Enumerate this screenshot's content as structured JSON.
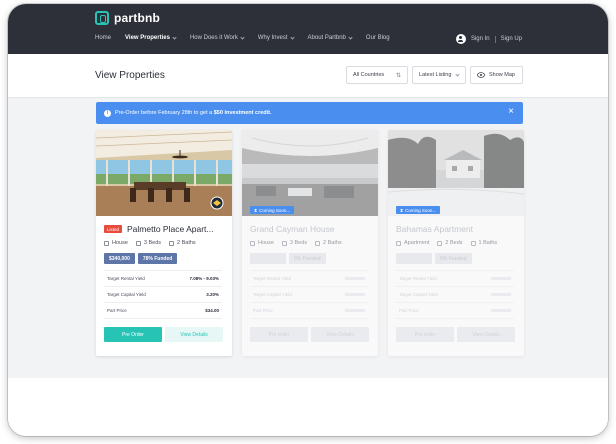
{
  "brand": {
    "name": "partbnb",
    "accent": "#27c4b6",
    "nav_bg": "#2d3039"
  },
  "nav": {
    "items": [
      {
        "label": "Home",
        "active": false,
        "dropdown": false
      },
      {
        "label": "View Properties",
        "active": true,
        "dropdown": true
      },
      {
        "label": "How Does it Work",
        "active": false,
        "dropdown": true
      },
      {
        "label": "Why Invest",
        "active": false,
        "dropdown": true
      },
      {
        "label": "About Partbnb",
        "active": false,
        "dropdown": true
      },
      {
        "label": "Our Blog",
        "active": false,
        "dropdown": false
      }
    ],
    "sign_in": "Sign In",
    "sign_up": "Sign Up"
  },
  "header": {
    "title": "View Properties",
    "country_select": "All Countries",
    "sort_select": "Latest Listing",
    "map_button": "Show Map"
  },
  "banner": {
    "text_before": "Pre-Order before February 28th to get a ",
    "text_bold": "$50 investment credit.",
    "color": "#4a8ff0"
  },
  "cards": [
    {
      "status": "Listed",
      "title": "Palmetto Place Apart...",
      "type": "House",
      "beds": "3 Beds",
      "baths": "2 Baths",
      "price_badge": "$340,000",
      "funded_badge": "78% Funded",
      "metrics": [
        {
          "label": "Target Rental Yield",
          "value": "7.08% - 9.03%"
        },
        {
          "label": "Target Capital Yield",
          "value": "3.20%"
        },
        {
          "label": "Part Price",
          "value": "$34.00"
        }
      ],
      "primary_button": "Pre Order",
      "secondary_button": "View Details"
    },
    {
      "status": "Coming Soon...",
      "title": "Grand Cayman House",
      "type": "House",
      "beds": "3 Beds",
      "baths": "2 Baths",
      "funded_badge": "0% Funded",
      "metrics": [
        {
          "label": "Target Rental Yield"
        },
        {
          "label": "Target Capital Yield"
        },
        {
          "label": "Part Price"
        }
      ],
      "primary_button": "Pre order",
      "secondary_button": "View Details"
    },
    {
      "status": "Coming Soon...",
      "title": "Bahamas Apartment",
      "type": "Apartment",
      "beds": "2 Beds",
      "baths": "1 Baths",
      "funded_badge": "0% Funded",
      "metrics": [
        {
          "label": "Target Rental Yield"
        },
        {
          "label": "Target Capital Yield"
        },
        {
          "label": "Part Price"
        }
      ],
      "primary_button": "Pre order",
      "secondary_button": "View Details"
    }
  ]
}
